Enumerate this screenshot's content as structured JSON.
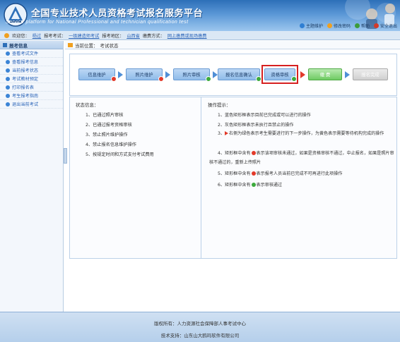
{
  "header": {
    "title": "全国专业技术人员资格考试报名服务平台",
    "subtitle": "Service platform for National Professional and technician qualification test",
    "links": [
      {
        "label": "主题维护",
        "icon": "theme-icon",
        "color": "#2f7fd3"
      },
      {
        "label": "修改密码",
        "icon": "password-icon",
        "color": "#f0a020"
      },
      {
        "label": "帮助",
        "icon": "help-icon",
        "color": "#3c9c3c"
      },
      {
        "label": "安全退出",
        "icon": "logout-icon",
        "color": "#d33a2a"
      }
    ]
  },
  "userbar": {
    "welcome_label": "欢迎您：",
    "welcome_value": "杨过",
    "exam_label": "报考考试：",
    "exam_value": "一级建造师考试",
    "region_label": "报考地区：",
    "region_value": "山西省",
    "payment_label": "缴费方式：",
    "payment_value": "网上缴费或现场缴费"
  },
  "sidebar": {
    "title": "报考信息",
    "items": [
      {
        "label": "查看考试文件"
      },
      {
        "label": "查看报考信息"
      },
      {
        "label": "当前报考状态"
      },
      {
        "label": "考试教材预定"
      },
      {
        "label": "打印报名表"
      },
      {
        "label": "考生报考指南"
      },
      {
        "label": "退出当前考试"
      }
    ]
  },
  "location": {
    "label": "当前位置：",
    "value": "考试状态"
  },
  "steps": [
    {
      "label": "信息维护",
      "style": "blue",
      "badge": "red"
    },
    {
      "label": "照片维护",
      "style": "blue",
      "badge": "red"
    },
    {
      "label": "照片审核",
      "style": "blue",
      "badge": "green"
    },
    {
      "label": "报名信息确认",
      "style": "blue",
      "badge": "green"
    },
    {
      "label": "资格审核",
      "style": "blue",
      "badge": "green"
    },
    {
      "label": "缴 费",
      "style": "green",
      "badge": ""
    },
    {
      "label": "报名完成",
      "style": "gray",
      "badge": ""
    }
  ],
  "status": {
    "title": "状态信息：",
    "lines": [
      "1、已通过照片审核",
      "2、已通过报考资格审核",
      "3、禁止照片维护操作",
      "4、禁止报名信息维护操作",
      "5、按规定时间和方式支付考试费用"
    ]
  },
  "tips": {
    "title": "操作提示：",
    "t1": "1、蓝色矩形框表示目前已完成或可以进行的操作",
    "t2": "2、灰色矩形框表示未执行且禁止的操作",
    "t3a": "3、",
    "t3b": "右侧为绿色表示考生需要进行的下一步操作，为黄色表示需要等待机构完成的操作",
    "t4a": "4、矩形框中含有",
    "t4b": "表示该项审核未通过，如果是资格审核不通过，中止报名，如果是照片审核不通过的，重新上传照片",
    "t5a": "5、矩形框中含有",
    "t5b": "表示报考人员当前已完成不可再进行此项操作",
    "t6a": "6、矩形框中含有",
    "t6b": "表示审核通过"
  },
  "footer": {
    "copyright_label": "版权所有：",
    "copyright_value": "人力资源社会保障部人事考试中心",
    "support_label": "技术支持：",
    "support_value": "山东山大鸥玛软件有限公司"
  }
}
